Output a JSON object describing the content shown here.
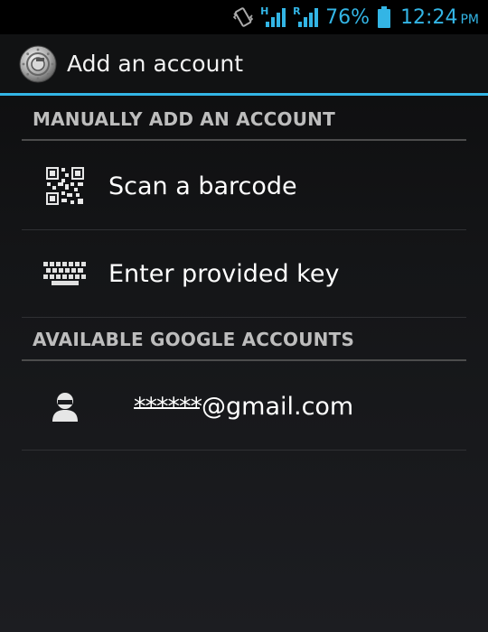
{
  "status_bar": {
    "network_h": "H",
    "network_r": "R",
    "battery_percent": "76%",
    "time": "12:24",
    "ampm": "PM",
    "accent_color": "#33b5e5"
  },
  "action_bar": {
    "title": "Add an account",
    "icon": "authenticator-app-icon"
  },
  "sections": {
    "manual": {
      "header": "MANUALLY ADD AN ACCOUNT",
      "items": [
        {
          "label": "Scan a barcode",
          "icon": "qr-code-icon"
        },
        {
          "label": "Enter provided key",
          "icon": "keyboard-icon"
        }
      ]
    },
    "google": {
      "header": "AVAILABLE GOOGLE ACCOUNTS",
      "accounts": [
        {
          "masked": "******",
          "domain": "@gmail.com",
          "icon": "person-icon"
        }
      ]
    }
  }
}
